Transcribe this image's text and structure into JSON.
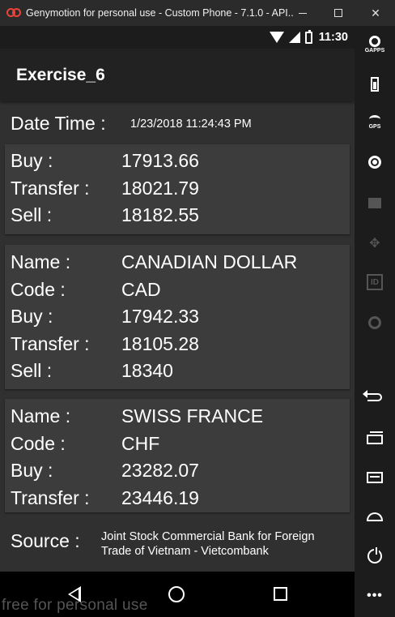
{
  "window": {
    "title": "Genymotion for personal use - Custom Phone - 7.1.0 - API..."
  },
  "statusbar": {
    "time": "11:30"
  },
  "app": {
    "title": "Exercise_6"
  },
  "date_time": {
    "label": "Date Time :",
    "value": "1/23/2018 11:24:43 PM"
  },
  "cards": [
    {
      "rows": [
        {
          "key": "Buy :",
          "value": "17913.66"
        },
        {
          "key": "Transfer :",
          "value": "18021.79"
        },
        {
          "key": "Sell :",
          "value": "18182.55"
        }
      ]
    },
    {
      "rows": [
        {
          "key": "Name :",
          "value": "CANADIAN DOLLAR"
        },
        {
          "key": "Code :",
          "value": "CAD"
        },
        {
          "key": "Buy :",
          "value": "17942.33"
        },
        {
          "key": "Transfer :",
          "value": "18105.28"
        },
        {
          "key": "Sell :",
          "value": "18340"
        }
      ]
    },
    {
      "rows": [
        {
          "key": "Name :",
          "value": "SWISS FRANCE"
        },
        {
          "key": "Code :",
          "value": "CHF"
        },
        {
          "key": "Buy :",
          "value": "23282.07"
        },
        {
          "key": "Transfer :",
          "value": "23446.19"
        }
      ]
    }
  ],
  "source": {
    "label": "Source :",
    "value": "Joint Stock Commercial Bank for Foreign Trade of Vietnam - Vietcombank"
  },
  "watermark": "free for personal use",
  "sidebar": {
    "gapps_label": "GAPPS",
    "gps_label": "GPS",
    "id_label": "ID",
    "more_label": "•••"
  },
  "colors": {
    "screen_bg": "#303030",
    "card_bg": "#3c3c3c",
    "appbar_bg": "#222222",
    "toolbar_bg": "#1c1c1c"
  }
}
